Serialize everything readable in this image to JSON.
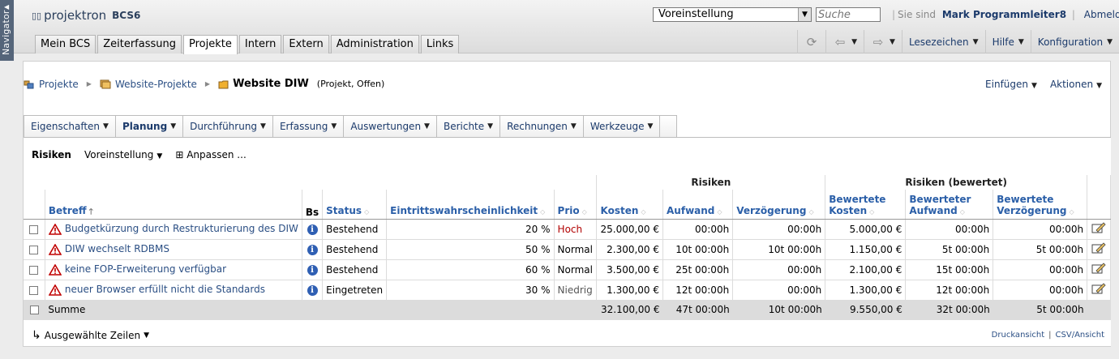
{
  "navigator": {
    "label": "Navigator"
  },
  "brand": {
    "name": "projektron",
    "product": "BCS",
    "version": "6"
  },
  "header": {
    "preset_value": "Voreinstellung",
    "search_placeholder": "Suche",
    "signed_in_label": "Sie sind",
    "user_name": "Mark Programmleiter8",
    "logout_label": "Abmelden"
  },
  "tabs": [
    {
      "label": "Mein BCS",
      "active": false
    },
    {
      "label": "Zeiterfassung",
      "active": false
    },
    {
      "label": "Projekte",
      "active": true
    },
    {
      "label": "Intern",
      "active": false
    },
    {
      "label": "Extern",
      "active": false
    },
    {
      "label": "Administration",
      "active": false
    },
    {
      "label": "Links",
      "active": false
    }
  ],
  "tools": {
    "bookmarks": "Lesezeichen",
    "help": "Hilfe",
    "config": "Konfiguration"
  },
  "breadcrumb": {
    "items": [
      "Projekte",
      "Website-Projekte"
    ],
    "current": "Website DIW",
    "meta": "(Projekt, Offen)"
  },
  "page_actions": {
    "insert": "Einfügen",
    "actions": "Aktionen"
  },
  "subnav": [
    {
      "label": "Eigenschaften",
      "bold": false
    },
    {
      "label": "Planung",
      "bold": true
    },
    {
      "label": "Durchführung",
      "bold": false
    },
    {
      "label": "Erfassung",
      "bold": false
    },
    {
      "label": "Auswertungen",
      "bold": false
    },
    {
      "label": "Berichte",
      "bold": false
    },
    {
      "label": "Rechnungen",
      "bold": false
    },
    {
      "label": "Werkzeuge",
      "bold": false
    }
  ],
  "panel": {
    "title": "Risiken",
    "preset": "Voreinstellung",
    "customize": "Anpassen ..."
  },
  "table": {
    "group_risks": "Risiken",
    "group_rated": "Risiken (bewertet)",
    "columns": {
      "subject": "Betreff",
      "bs": "Bs",
      "status": "Status",
      "probability": "Eintrittswahrscheinlichkeit",
      "prio": "Prio",
      "cost": "Kosten",
      "effort": "Aufwand",
      "delay": "Verzögerung",
      "rated_cost_1": "Bewertete",
      "rated_cost_2": "Kosten",
      "rated_effort_1": "Bewerteter",
      "rated_effort_2": "Aufwand",
      "rated_delay_1": "Bewertete",
      "rated_delay_2": "Verzögerung"
    },
    "rows": [
      {
        "subject": "Budgetkürzung durch Restrukturierung des DIW",
        "status": "Bestehend",
        "probability": "20 %",
        "prio": "Hoch",
        "cost": "25.000,00 €",
        "effort": "00:00h",
        "delay": "00:00h",
        "rated_cost": "5.000,00 €",
        "rated_effort": "00:00h",
        "rated_delay": "00:00h"
      },
      {
        "subject": "DIW wechselt RDBMS",
        "status": "Bestehend",
        "probability": "50 %",
        "prio": "Normal",
        "cost": "2.300,00 €",
        "effort": "10t 00:00h",
        "delay": "10t 00:00h",
        "rated_cost": "1.150,00 €",
        "rated_effort": "5t 00:00h",
        "rated_delay": "5t 00:00h"
      },
      {
        "subject": "keine FOP-Erweiterung verfügbar",
        "status": "Bestehend",
        "probability": "60 %",
        "prio": "Normal",
        "cost": "3.500,00 €",
        "effort": "25t 00:00h",
        "delay": "00:00h",
        "rated_cost": "2.100,00 €",
        "rated_effort": "15t 00:00h",
        "rated_delay": "00:00h"
      },
      {
        "subject": "neuer Browser erfüllt nicht die Standards",
        "status": "Eingetreten",
        "probability": "30 %",
        "prio": "Niedrig",
        "cost": "1.300,00 €",
        "effort": "12t 00:00h",
        "delay": "00:00h",
        "rated_cost": "1.300,00 €",
        "rated_effort": "12t 00:00h",
        "rated_delay": "00:00h"
      }
    ],
    "sum": {
      "label": "Summe",
      "cost": "32.100,00 €",
      "effort": "47t 00:00h",
      "delay": "10t 00:00h",
      "rated_cost": "9.550,00 €",
      "rated_effort": "32t 00:00h",
      "rated_delay": "5t 00:00h"
    }
  },
  "footer": {
    "selected_rows": "Ausgewählte Zeilen",
    "print": "Druckansicht",
    "csv": "CSV/Ansicht"
  },
  "colors": {
    "link": "#2b4f84",
    "header_text": "#2b5fa8",
    "prio_high": "#b10000",
    "warn": "#c00000",
    "info": "#2f5fb3"
  }
}
